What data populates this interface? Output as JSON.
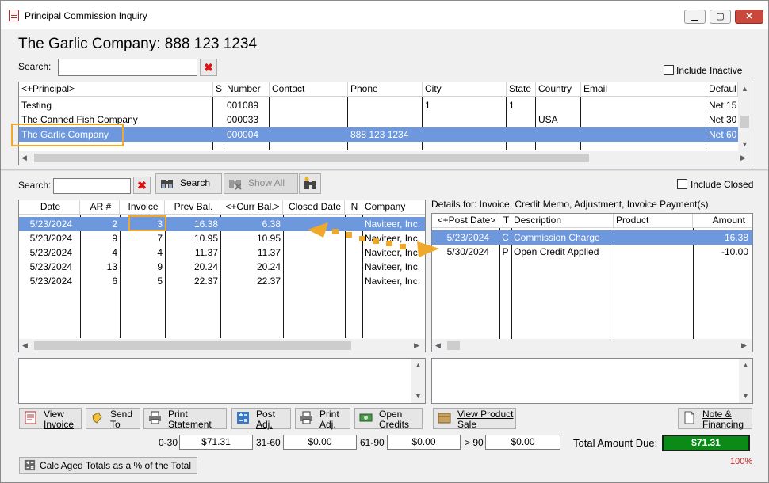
{
  "window": {
    "title": "Principal Commission Inquiry",
    "minimize": "▁",
    "maximize": "▢",
    "close": "✕"
  },
  "heading": "The Garlic Company: 888 123 1234",
  "principal_search": {
    "label": "Search:",
    "value": "",
    "clear": "✖"
  },
  "include_inactive": "Include Inactive",
  "principals": {
    "columns": [
      "<+Principal>",
      "S",
      "Number",
      "Contact",
      "Phone",
      "City",
      "State",
      "Country",
      "Email",
      "Defaul"
    ],
    "rows": [
      {
        "principal": "Testing",
        "s": "",
        "number": "001089",
        "contact": "",
        "phone": "",
        "city": "1",
        "state": "1",
        "country": "",
        "email": "",
        "default": "Net 15"
      },
      {
        "principal": "The Canned Fish Company",
        "s": "",
        "number": "000033",
        "contact": "",
        "phone": "",
        "city": "",
        "state": "",
        "country": "USA",
        "email": "",
        "default": "Net 30"
      },
      {
        "principal": "The Garlic Company",
        "s": "",
        "number": "000004",
        "contact": "",
        "phone": "888 123 1234",
        "city": "",
        "state": "",
        "country": "",
        "email": "",
        "default": "Net 60"
      }
    ]
  },
  "invoice_search": {
    "label": "Search:",
    "value": "",
    "clear": "✖",
    "search_button": "Search",
    "show_all_button": "Show All"
  },
  "include_closed": "Include Closed",
  "invoices": {
    "columns": [
      "Date",
      "AR #",
      "Invoice",
      "Prev Bal.",
      "<+Curr Bal.>",
      "Closed Date",
      "N",
      "Company"
    ],
    "rows": [
      {
        "date": "5/23/2024",
        "ar": "2",
        "invoice": "3",
        "prev": "16.38",
        "curr": "6.38",
        "closed": "",
        "n": "",
        "company": "Naviteer, Inc."
      },
      {
        "date": "5/23/2024",
        "ar": "9",
        "invoice": "7",
        "prev": "10.95",
        "curr": "10.95",
        "closed": "",
        "n": "",
        "company": "Naviteer, Inc."
      },
      {
        "date": "5/23/2024",
        "ar": "4",
        "invoice": "4",
        "prev": "11.37",
        "curr": "11.37",
        "closed": "",
        "n": "",
        "company": "Naviteer, Inc."
      },
      {
        "date": "5/23/2024",
        "ar": "13",
        "invoice": "9",
        "prev": "20.24",
        "curr": "20.24",
        "closed": "",
        "n": "",
        "company": "Naviteer, Inc."
      },
      {
        "date": "5/23/2024",
        "ar": "6",
        "invoice": "5",
        "prev": "22.37",
        "curr": "22.37",
        "closed": "",
        "n": "",
        "company": "Naviteer, Inc."
      }
    ]
  },
  "details": {
    "label": "Details for: Invoice, Credit Memo, Adjustment, Invoice Payment(s)",
    "columns": [
      "<+Post Date>",
      "T",
      "Description",
      "Product",
      "Amount"
    ],
    "rows": [
      {
        "post_date": "5/23/2024",
        "t": "C",
        "description": "Commission Charge",
        "product": "",
        "amount": "16.38"
      },
      {
        "post_date": "5/30/2024",
        "t": "P",
        "description": "Open Credit Applied",
        "product": "",
        "amount": "-10.00"
      }
    ]
  },
  "buttons": {
    "view_invoice": [
      "View",
      "Invoice"
    ],
    "send_to": [
      "Send",
      "To"
    ],
    "print_statement": [
      "Print",
      "Statement"
    ],
    "post_adj": [
      "Post",
      "Adj."
    ],
    "print_adj": [
      "Print",
      "Adj."
    ],
    "open_credits": [
      "Open",
      "Credits"
    ],
    "view_product_sale": [
      "View Product",
      "Sale"
    ],
    "note_financing": [
      "Note &",
      "Financing"
    ],
    "calc_aged": "Calc Aged Totals as a % of the Total"
  },
  "aging": {
    "b0_30_label": "0-30",
    "b0_30": "$71.31",
    "b31_60_label": "31-60",
    "b31_60": "$0.00",
    "b61_90_label": "61-90",
    "b61_90": "$0.00",
    "b90_label": "> 90",
    "b90": "$0.00",
    "total_label": "Total Amount Due:",
    "total": "$71.31",
    "percent": "100%"
  },
  "colors": {
    "selection": "#6d98dd",
    "highlight": "#f0a82a",
    "total_bg": "#0a8a16",
    "percent": "#c0282a"
  }
}
